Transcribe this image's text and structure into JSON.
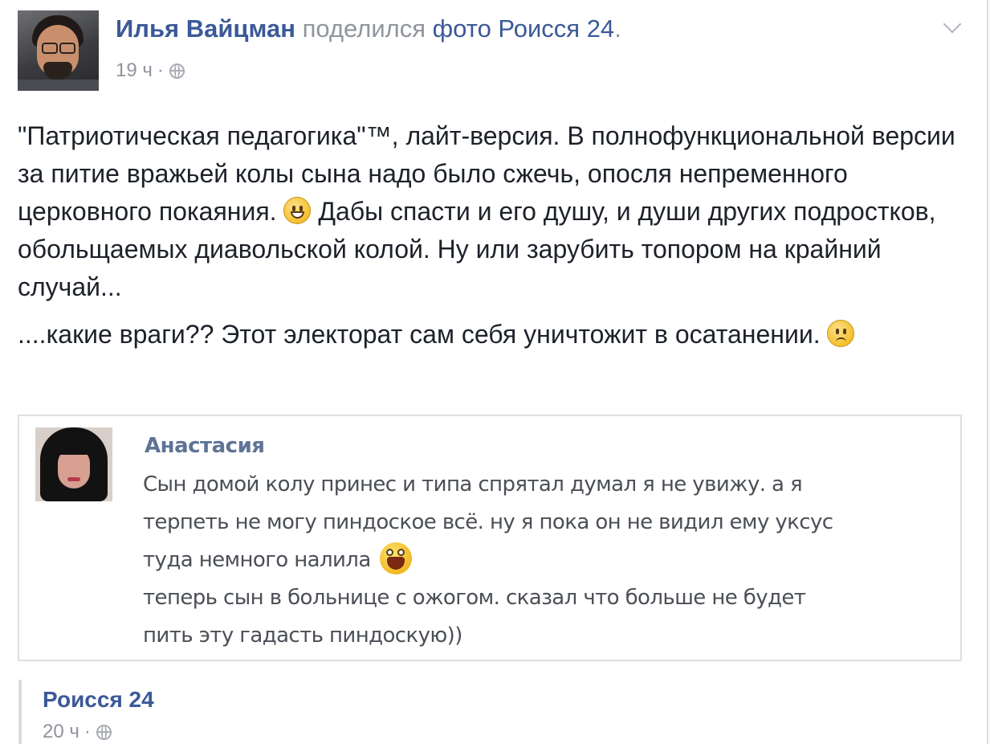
{
  "post": {
    "author": "Илья Вайцман",
    "action": "поделился",
    "target": "фото Роисся 24",
    "period": ".",
    "time": "19 ч",
    "separator": "·",
    "privacy_icon": "globe-icon",
    "menu_icon": "chevron-down-icon",
    "paragraph1_part1": "\"Патриотическая педагогика\"™, лайт-версия. В полнофункциональной версии за питие вражьей колы сына надо было сжечь, опосля непременного церковного покаяния.",
    "paragraph1_part2": "Дабы спасти и его душу, и души других подростков, обольщаемых диавольской колой. Ну или зарубить топором на крайний случай...",
    "paragraph2": "....какие враги?? Этот электорат сам себя уничтожит в осатанении.",
    "emoji1": "smiley-icon",
    "emoji2": "confused-face-icon"
  },
  "shared_image": {
    "name": "Анастасия",
    "lines": [
      "Сын домой колу принес и типа спрятал думал я не увижу. а я",
      "терпеть не могу пиндоское всё. ну я пока он не видил ему уксус",
      "туда немного налила",
      "теперь сын в больнице с ожогом. сказал что больше не будет",
      "пить эту гадасть пиндоскую))"
    ],
    "emoji": "laughing-face-icon"
  },
  "attribution": {
    "name": "Роисся 24",
    "time": "20 ч",
    "separator": "·"
  }
}
